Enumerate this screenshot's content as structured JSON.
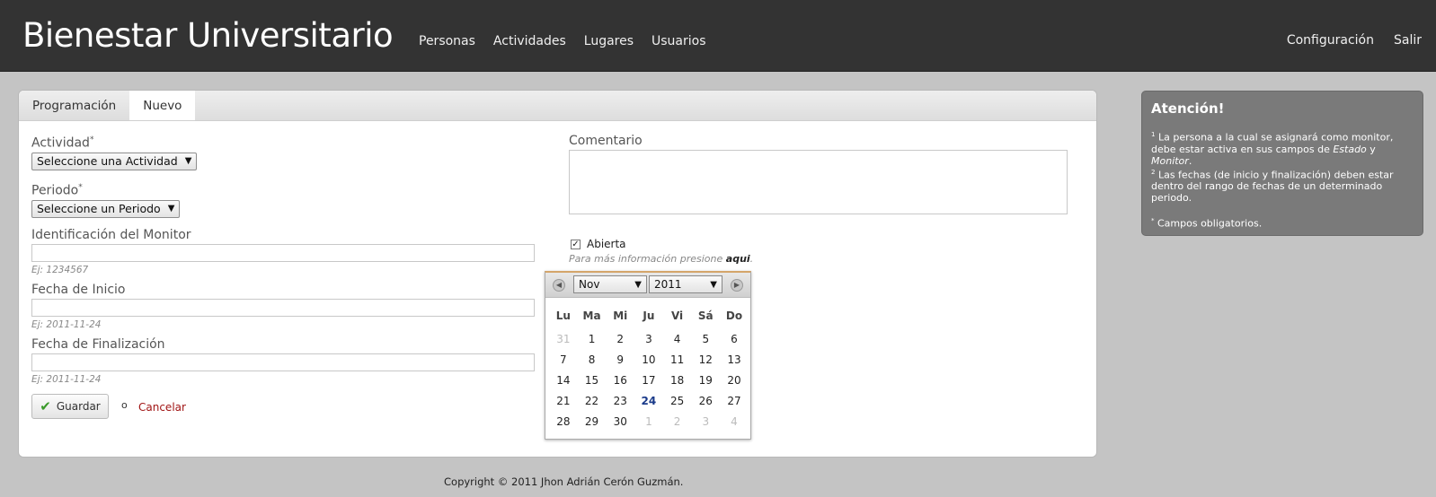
{
  "brand": "Bienestar Universitario",
  "nav": {
    "main": [
      "Personas",
      "Actividades",
      "Lugares",
      "Usuarios"
    ],
    "right": [
      "Configuración",
      "Salir"
    ]
  },
  "tabs": [
    {
      "label": "Programación",
      "active": false
    },
    {
      "label": "Nuevo",
      "active": true
    }
  ],
  "form": {
    "actividad": {
      "label": "Actividad",
      "selected": "Seleccione una Actividad"
    },
    "periodo": {
      "label": "Periodo",
      "selected": "Seleccione un Periodo"
    },
    "monitor": {
      "label": "Identificación del Monitor",
      "hint": "Ej: 1234567"
    },
    "fecha_inicio": {
      "label": "Fecha de Inicio",
      "hint": "Ej: 2011-11-24"
    },
    "fecha_fin": {
      "label": "Fecha de Finalización",
      "hint": "Ej: 2011-11-24"
    },
    "comentario": {
      "label": "Comentario"
    },
    "abierta": {
      "label": "Abierta",
      "checked": true,
      "check_glyph": "✓"
    },
    "more_info_text": "Para más información presione ",
    "more_info_link": "aqui",
    "more_info_end": ".",
    "save_label": "Guardar",
    "or_label": "o",
    "cancel_label": "Cancelar",
    "required_mark": "*"
  },
  "sidebar": {
    "title": "Atención!",
    "note1_sup": "1",
    "note1_a": " La persona a la cual se asignará como monitor, debe estar activa en sus campos de ",
    "note1_b": "Estado",
    "note1_c": " y ",
    "note1_d": "Monitor",
    "note1_e": ".",
    "note2_sup": "2",
    "note2": " Las fechas (de inicio y finalización) deben estar dentro del rango de fechas de un determinado periodo.",
    "note3_sup": "*",
    "note3": " Campos obligatorios."
  },
  "datepicker": {
    "month": "Nov",
    "year": "2011",
    "weekdays": [
      "Lu",
      "Ma",
      "Mi",
      "Ju",
      "Vi",
      "Sá",
      "Do"
    ],
    "weeks": [
      [
        "31",
        "1",
        "2",
        "3",
        "4",
        "5",
        "6"
      ],
      [
        "7",
        "8",
        "9",
        "10",
        "11",
        "12",
        "13"
      ],
      [
        "14",
        "15",
        "16",
        "17",
        "18",
        "19",
        "20"
      ],
      [
        "21",
        "22",
        "23",
        "24",
        "25",
        "26",
        "27"
      ],
      [
        "28",
        "29",
        "30",
        "1",
        "2",
        "3",
        "4"
      ]
    ],
    "today": "24"
  },
  "footer": "Copyright © 2011 Jhon Adrián Cerón Guzmán.",
  "colors": {
    "topbar": "#333333",
    "sidebar": "#7a7a7a",
    "cancel": "#a11515",
    "check": "#3a9a2a"
  }
}
